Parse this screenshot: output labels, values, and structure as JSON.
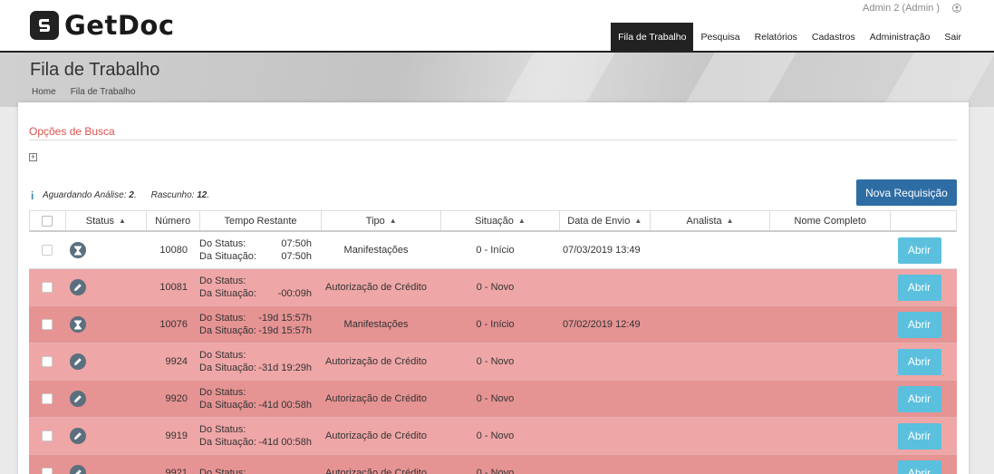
{
  "brand": {
    "name": "GetDoc"
  },
  "user": {
    "label": "Admin 2 (Admin )"
  },
  "nav": [
    {
      "label": "Fila de Trabalho",
      "active": true
    },
    {
      "label": "Pesquisa"
    },
    {
      "label": "Relatórios"
    },
    {
      "label": "Cadastros"
    },
    {
      "label": "Administração"
    },
    {
      "label": "Sair"
    }
  ],
  "page": {
    "title": "Fila de Trabalho",
    "breadcrumb": [
      "Home",
      "Fila de Trabalho"
    ]
  },
  "search": {
    "title": "Opções de Busca",
    "expand": "+"
  },
  "summary": {
    "aguardando_label": "Aguardando Análise:",
    "aguardando_value": "2",
    "rascunho_label": "Rascunho:",
    "rascunho_value": "12"
  },
  "new_request": {
    "label": "Nova Requisição"
  },
  "table": {
    "headers": {
      "status": "Status",
      "numero": "Número",
      "tempo": "Tempo Restante",
      "tipo": "Tipo",
      "situacao": "Situação",
      "data": "Data de Envio",
      "analista": "Analista",
      "nome": "Nome Completo"
    },
    "rows": [
      {
        "icon": "hourglass-icon",
        "numero": "10080",
        "do_status_label": "Do Status:",
        "do_status": "07:50h",
        "da_situacao_label": "Da Situação:",
        "da_situacao": "07:50h",
        "tipo": "Manifestações",
        "situacao": "0 - Início",
        "data": "07/03/2019 13:49",
        "analista": "",
        "nome": "",
        "acao": "Abrir"
      },
      {
        "icon": "pencil-icon",
        "numero": "10081",
        "do_status_label": "Do Status:",
        "do_status": "",
        "da_situacao_label": "Da Situação:",
        "da_situacao": "-00:09h",
        "tipo": "Autorização de Crédito",
        "situacao": "0 - Novo",
        "data": "",
        "analista": "",
        "nome": "",
        "acao": "Abrir"
      },
      {
        "icon": "hourglass-icon",
        "numero": "10076",
        "do_status_label": "Do Status:",
        "do_status": "-19d 15:57h",
        "da_situacao_label": "Da Situação:",
        "da_situacao": "-19d 15:57h",
        "tipo": "Manifestações",
        "situacao": "0 - Início",
        "data": "07/02/2019 12:49",
        "analista": "",
        "nome": "",
        "acao": "Abrir"
      },
      {
        "icon": "pencil-icon",
        "numero": "9924",
        "do_status_label": "Do Status:",
        "do_status": "",
        "da_situacao_label": "Da Situação:",
        "da_situacao": "-31d 19:29h",
        "tipo": "Autorização de Crédito",
        "situacao": "0 - Novo",
        "data": "",
        "analista": "",
        "nome": "",
        "acao": "Abrir"
      },
      {
        "icon": "pencil-icon",
        "numero": "9920",
        "do_status_label": "Do Status:",
        "do_status": "",
        "da_situacao_label": "Da Situação:",
        "da_situacao": "-41d 00:58h",
        "tipo": "Autorização de Crédito",
        "situacao": "0 - Novo",
        "data": "",
        "analista": "",
        "nome": "",
        "acao": "Abrir"
      },
      {
        "icon": "pencil-icon",
        "numero": "9919",
        "do_status_label": "Do Status:",
        "do_status": "",
        "da_situacao_label": "Da Situação:",
        "da_situacao": "-41d 00:58h",
        "tipo": "Autorização de Crédito",
        "situacao": "0 - Novo",
        "data": "",
        "analista": "",
        "nome": "",
        "acao": "Abrir"
      },
      {
        "icon": "pencil-icon",
        "numero": "9921",
        "do_status_label": "Do Status:",
        "do_status": "",
        "da_situacao_label": "",
        "da_situacao": "",
        "tipo": "Autorização de Crédito",
        "situacao": "0 - Novo",
        "data": "",
        "analista": "",
        "nome": "",
        "acao": "Abrir"
      }
    ]
  },
  "colors": {
    "nav_active_bg": "#222222",
    "search_title": "#d9534f",
    "primary_button": "#2e6da4",
    "open_button": "#5bc0de",
    "row_pink": "#efa6a6",
    "row_pink_dark": "#e69393",
    "status_icon": "#5b6f7e"
  }
}
